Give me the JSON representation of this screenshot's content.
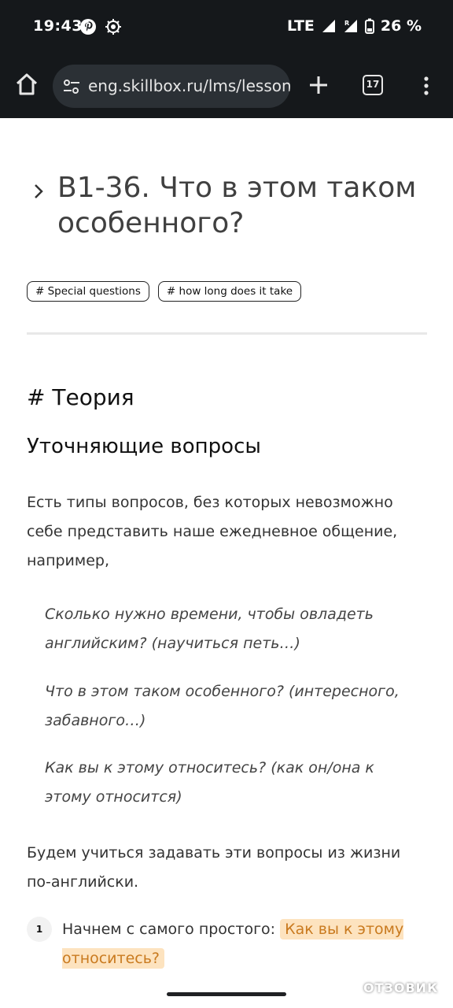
{
  "status_bar": {
    "time": "19:43",
    "network": "LTE",
    "battery": "26 %"
  },
  "browser": {
    "url": "eng.skillbox.ru/lms/lessons",
    "tab_count": "17"
  },
  "lesson": {
    "title": "B1-36. Что в этом таком особенного?",
    "tags": [
      "# Special questions",
      "# how long does it take"
    ],
    "section_heading": "# Теория",
    "subheading": "Уточняющие вопросы",
    "intro": "Есть типы вопросов, без которых невозможно себе представить наше ежедневное общение, например,",
    "examples": [
      "Сколько нужно времени, чтобы овладеть английским? (научиться петь…)",
      "Что в этом таком особенного? (интересного, забавного…)",
      "Как вы к этому относитесь? (как он/она к этому относится)"
    ],
    "goal": "Будем учиться задавать эти вопросы из жизни по-английски.",
    "step": {
      "number": "1",
      "text": "Начнем с самого простого:",
      "highlight": "Как вы к этому относитесь?"
    }
  },
  "watermark": "ОТЗОВИК",
  "colors": {
    "status_bg": "#15181b",
    "url_pill": "#2b3035",
    "highlight_bg": "#fde3bf",
    "highlight_text": "#c97a1f"
  }
}
